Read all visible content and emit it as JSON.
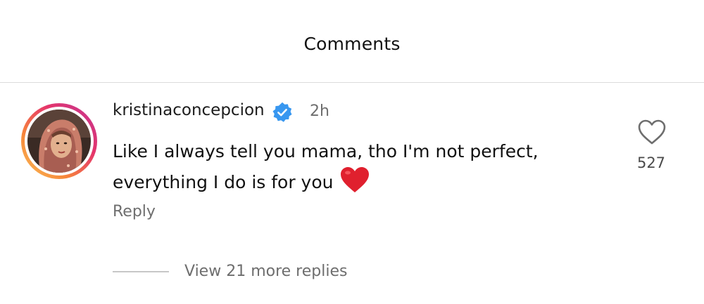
{
  "header": {
    "title": "Comments"
  },
  "comment": {
    "avatar_icon": "profile-photo",
    "username": "kristinaconcepcion",
    "verified_icon": "verified-badge-icon",
    "time": "2h",
    "text_line1": "Like I always tell you mama, tho I'm not perfect,",
    "text_line2": "everything I do is for you",
    "emoji": "red-heart",
    "reply_label": "Reply",
    "like_icon": "heart-outline-icon",
    "like_count": "527",
    "view_replies_label": "View 21 more replies"
  },
  "colors": {
    "text_primary": "#111111",
    "text_secondary": "#6e6e6e",
    "verified_blue": "#3897f0",
    "heart_red": "#e0202e",
    "divider": "#dbdbdb"
  }
}
